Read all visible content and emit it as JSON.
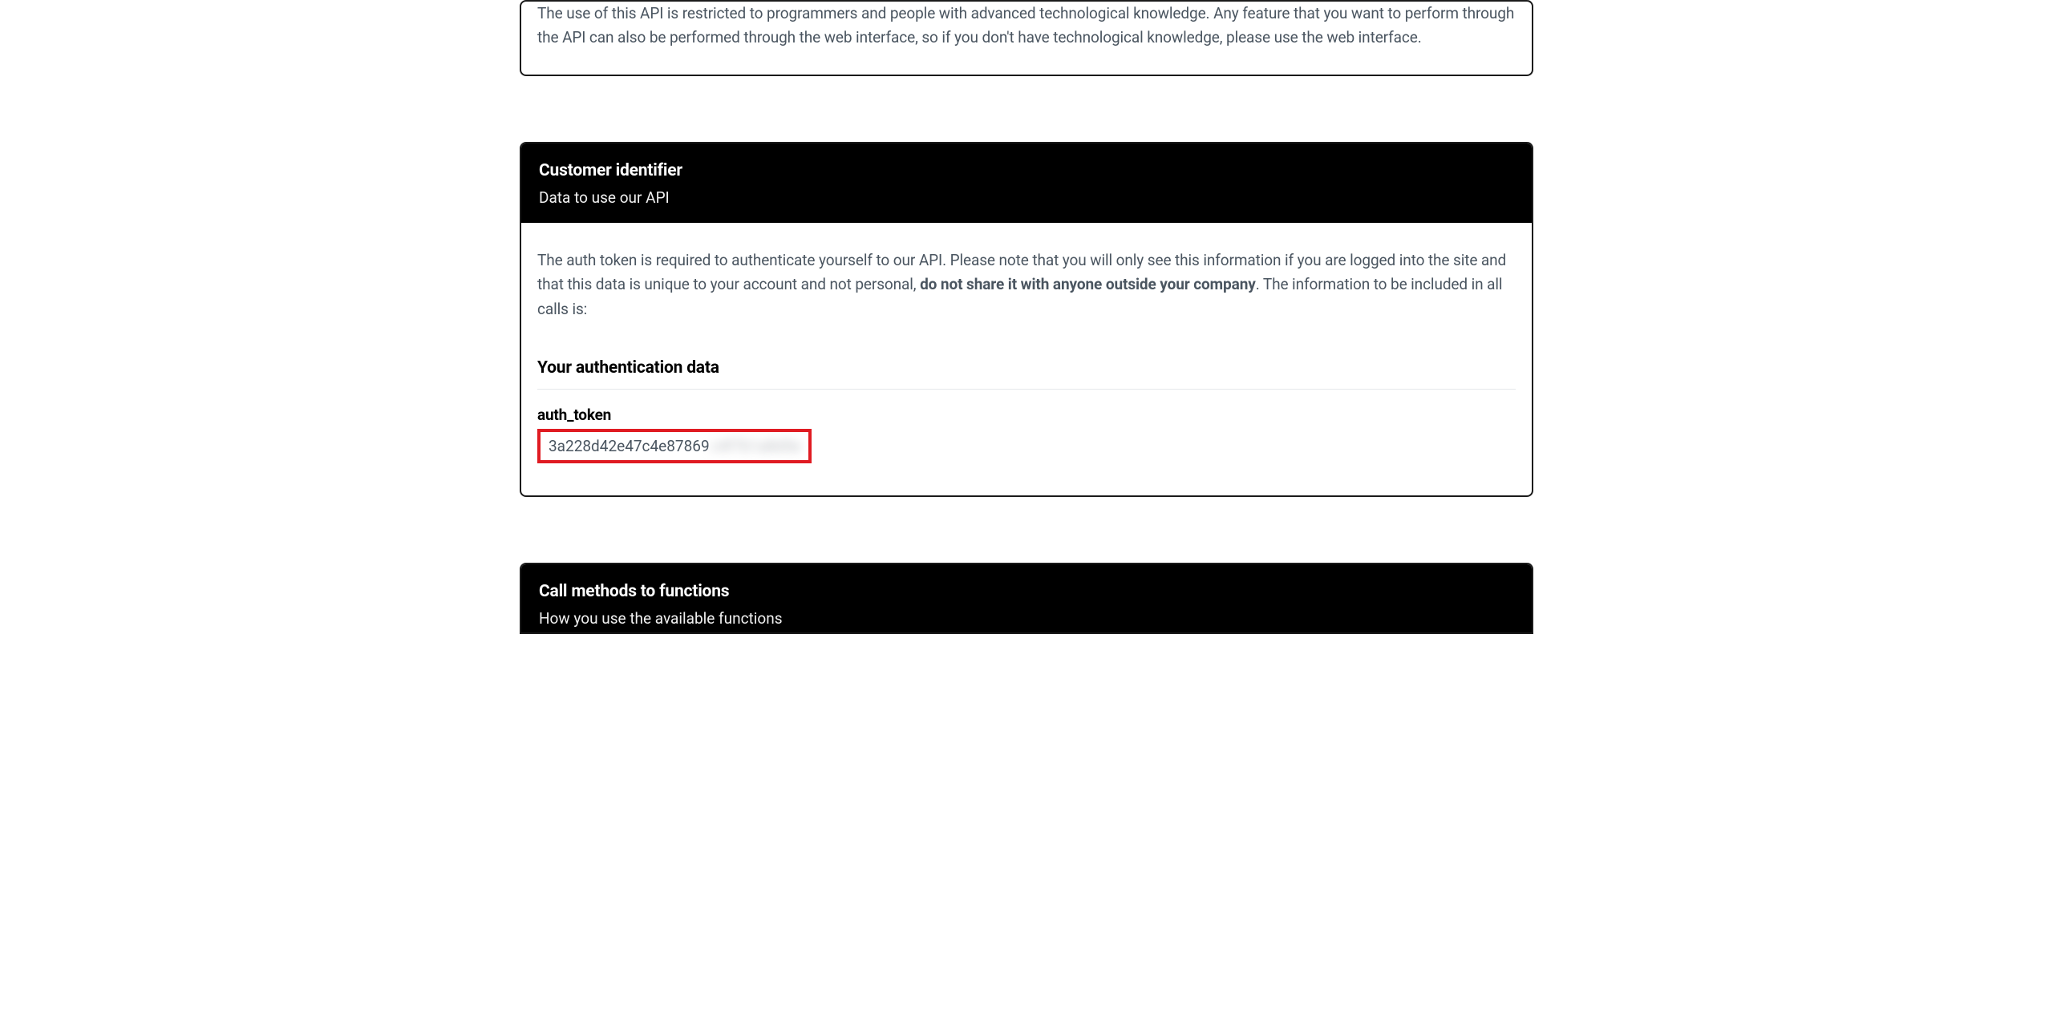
{
  "topCard": {
    "text": "The use of this API is restricted to programmers and people with advanced technological knowledge. Any feature that you want to perform through the API can also be performed through the web interface, so if you don't have technological knowledge, please use the web interface."
  },
  "customerCard": {
    "title": "Customer identifier",
    "subtitle": "Data to use our API",
    "body_pre": "The auth token is required to authenticate yourself to our API. Please note that you will only see this information if you are logged into the site and that this data is unique to your account and not personal, ",
    "body_bold": "do not share it with anyone outside your company",
    "body_post": ". The information to be included in all calls is:",
    "authTitle": "Your authentication data",
    "tokenLabel": "auth_token",
    "tokenVisible": "3a228d42e47c4e87869",
    "tokenHidden": "c4f7b1a8d5e"
  },
  "bottomCard": {
    "title": "Call methods to functions",
    "subtitle": "How you use the available functions"
  }
}
